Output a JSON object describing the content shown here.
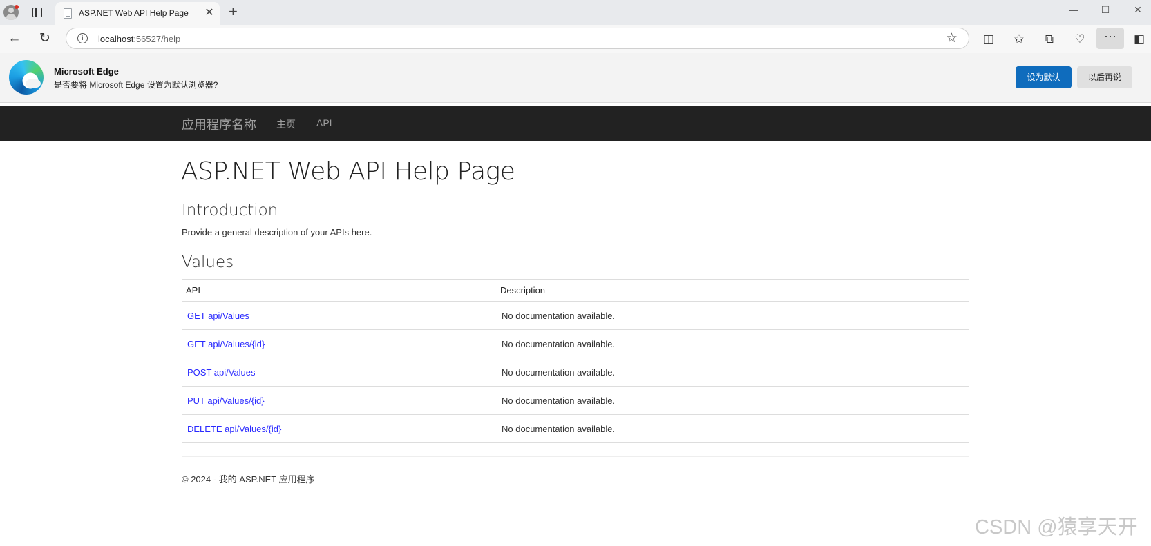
{
  "browser": {
    "tab": {
      "title": "ASP.NET Web API Help Page",
      "close_glyph": "✕"
    },
    "new_tab_glyph": "+",
    "window_controls": {
      "minimize": "—",
      "maximize": "☐",
      "close": "✕"
    },
    "url": {
      "host": "localhost",
      "path": ":56527/help"
    },
    "icons": [
      "profile-avatar",
      "tabs-icon",
      "back-icon",
      "reload-icon",
      "info-icon",
      "favorite-star-icon",
      "split-screen-icon",
      "favorites-icon",
      "collections-icon",
      "browser-essentials-icon",
      "more-icon",
      "sidebar-icon"
    ]
  },
  "infobar": {
    "title": "Microsoft Edge",
    "message": "是否要将 Microsoft Edge 设置为默认浏览器?",
    "primary_button": "设为默认",
    "secondary_button": "以后再说"
  },
  "navbar": {
    "brand": "应用程序名称",
    "links": [
      "主页",
      "API"
    ],
    "background": "#222222"
  },
  "page": {
    "title": "ASP.NET Web API Help Page",
    "intro_heading": "Introduction",
    "intro_text": "Provide a general description of your APIs here.",
    "section_heading": "Values",
    "table": {
      "headers": [
        "API",
        "Description"
      ],
      "rows": [
        {
          "api": "GET api/Values",
          "description": "No documentation available."
        },
        {
          "api": "GET api/Values/{id}",
          "description": "No documentation available."
        },
        {
          "api": "POST api/Values",
          "description": "No documentation available."
        },
        {
          "api": "PUT api/Values/{id}",
          "description": "No documentation available."
        },
        {
          "api": "DELETE api/Values/{id}",
          "description": "No documentation available."
        }
      ]
    },
    "footer": "© 2024 - 我的 ASP.NET 应用程序",
    "link_color": "#2a2aff"
  },
  "watermark": "CSDN @猿享天开"
}
